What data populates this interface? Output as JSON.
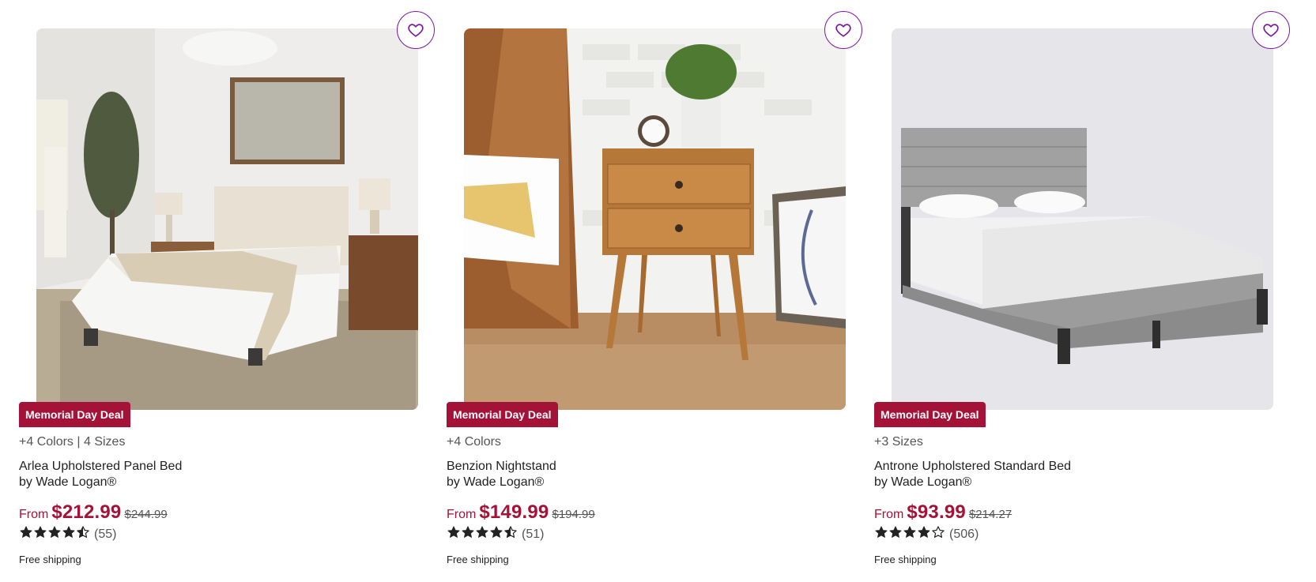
{
  "products": [
    {
      "deal_badge": "Memorial Day Deal",
      "options": "+4 Colors | 4 Sizes",
      "name": "Arlea Upholstered Panel Bed",
      "brand": "by Wade Logan®",
      "price_prefix": "From",
      "price": "$212.99",
      "original_price": "$244.99",
      "rating": 4.5,
      "review_count": "(55)",
      "shipping": "Free shipping",
      "image_icon": "bed-photo"
    },
    {
      "deal_badge": "Memorial Day Deal",
      "options": "+4 Colors",
      "name": "Benzion Nightstand",
      "brand": "by Wade Logan®",
      "price_prefix": "From",
      "price": "$149.99",
      "original_price": "$194.99",
      "rating": 4.5,
      "review_count": "(51)",
      "shipping": "Free shipping",
      "image_icon": "nightstand-photo"
    },
    {
      "deal_badge": "Memorial Day Deal",
      "options": "+3 Sizes",
      "name": "Antrone Upholstered Standard Bed",
      "brand": "by Wade Logan®",
      "price_prefix": "From",
      "price": "$93.99",
      "original_price": "$214.27",
      "rating": 4.0,
      "review_count": "(506)",
      "shipping": "Free shipping",
      "image_icon": "gray-bed-photo"
    }
  ],
  "colors": {
    "accent": "#a51237",
    "favorite_outline": "#7b189f",
    "star": "#222222"
  },
  "icons": {
    "favorite": "heart-outline-icon",
    "star_full": "star-filled-icon",
    "star_half": "star-half-icon",
    "star_empty": "star-outline-icon"
  }
}
